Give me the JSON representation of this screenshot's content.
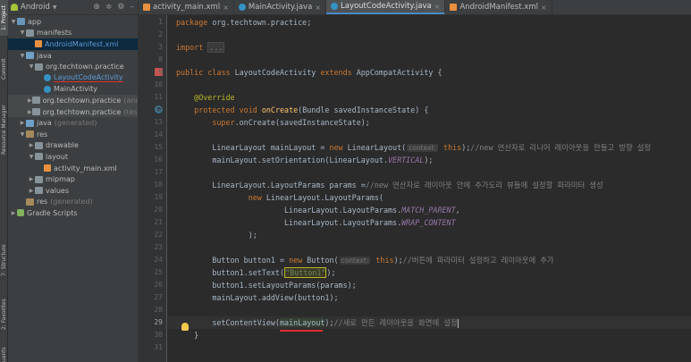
{
  "tool_strip": {
    "project": "1: Project",
    "commit": "Commit",
    "resource_manager": "Resource Manager",
    "structure": "7: Structure",
    "favorites": "2: Favorites",
    "build_variants": "uants"
  },
  "project_panel": {
    "view_selector": "Android",
    "tree": [
      {
        "label": "app",
        "indent": 0,
        "arrow": "▼",
        "icon": "folder-app"
      },
      {
        "label": "manifests",
        "indent": 1,
        "arrow": "▼",
        "icon": "folder"
      },
      {
        "label": "AndroidManifest.xml",
        "indent": 2,
        "arrow": "",
        "icon": "xml-file",
        "selected": true
      },
      {
        "label": "java",
        "indent": 1,
        "arrow": "▼",
        "icon": "folder-src"
      },
      {
        "label": "org.techtown.practice",
        "indent": 2,
        "arrow": "▼",
        "icon": "package"
      },
      {
        "label": "LayoutCodeActivity",
        "indent": 3,
        "arrow": "",
        "icon": "class"
      },
      {
        "label": "MainActivity",
        "indent": 3,
        "arrow": "",
        "icon": "class"
      },
      {
        "label": "org.techtown.practice",
        "suffix": "(andro",
        "indent": 2,
        "arrow": "▶",
        "icon": "package",
        "gray": true
      },
      {
        "label": "org.techtown.practice",
        "suffix": "(test)",
        "indent": 2,
        "arrow": "▶",
        "icon": "package",
        "gray": true
      },
      {
        "label": "java",
        "suffix": "(generated)",
        "indent": 1,
        "arrow": "▶",
        "icon": "folder-src"
      },
      {
        "label": "res",
        "indent": 1,
        "arrow": "▼",
        "icon": "folder-res"
      },
      {
        "label": "drawable",
        "indent": 2,
        "arrow": "▶",
        "icon": "folder"
      },
      {
        "label": "layout",
        "indent": 2,
        "arrow": "▼",
        "icon": "folder"
      },
      {
        "label": "activity_main.xml",
        "indent": 3,
        "arrow": "",
        "icon": "layout-file"
      },
      {
        "label": "mipmap",
        "indent": 2,
        "arrow": "▶",
        "icon": "folder"
      },
      {
        "label": "values",
        "indent": 2,
        "arrow": "▶",
        "icon": "folder"
      },
      {
        "label": "res",
        "suffix": "(generated)",
        "indent": 1,
        "arrow": "",
        "icon": "folder-res"
      },
      {
        "label": "Gradle Scripts",
        "indent": 0,
        "arrow": "▶",
        "icon": "gradle"
      }
    ]
  },
  "tabs": [
    {
      "label": "activity_main.xml",
      "icon": "layout-file"
    },
    {
      "label": "MainActivity.java",
      "icon": "class"
    },
    {
      "label": "LayoutCodeActivity.java",
      "icon": "class",
      "active": true
    },
    {
      "label": "AndroidManifest.xml",
      "icon": "xml-file"
    }
  ],
  "line_numbers": [
    "1",
    "2",
    "3",
    "8",
    "9",
    "10",
    "11",
    "12",
    "13",
    "14",
    "15",
    "16",
    "17",
    "18",
    "19",
    "20",
    "21",
    "22",
    "23",
    "24",
    "25",
    "26",
    "27",
    "28",
    "29",
    "30",
    "31"
  ],
  "current_line": "29",
  "code": {
    "l1_kw": "package",
    "l1_pkg": " org.techtown.practice;",
    "l3_kw": "import",
    "l3_fold": "...",
    "l8_kw1": "public",
    "l8_kw2": "class",
    "l8_name": " LayoutCodeActivity ",
    "l8_kw3": "extends",
    "l8_rest": " AppCompatActivity {",
    "l10_ann": "@Override",
    "l11_kw1": "protected",
    "l11_kw2": "void",
    "l11_fn": "onCreate",
    "l11_rest": "(Bundle savedInstanceState) {",
    "l12_kw": "super",
    "l12_rest": ".onCreate(savedInstanceState);",
    "l14_a": "LinearLayout mainLayout = ",
    "l14_kw": "new",
    "l14_b": " LinearLayout(",
    "l14_hint": "context:",
    "l14_this": "this",
    "l14_c": ");",
    "l14_cm": "//new 연산자로 리니어 레이아웃을 만들고 방향 설정",
    "l15_a": "mainLayout.setOrientation(LinearLayout.",
    "l15_cn": "VERTICAL",
    "l15_b": ");",
    "l17_a": "LinearLayout.LayoutParams params =",
    "l17_cm": "//new 연산자로 레이아웃 안에 추가도리 뷰들에 설정할 파라미터 생성",
    "l18_kw": "new",
    "l18_a": " LinearLayout.LayoutParams(",
    "l19_a": "LinearLayout.LayoutParams.",
    "l19_cn": "MATCH_PARENT",
    "l19_b": ",",
    "l20_a": "LinearLayout.LayoutParams.",
    "l20_cn": "WRAP_CONTENT",
    "l21_a": ");",
    "l23_a": "Button button1 = ",
    "l23_kw": "new",
    "l23_b": " Button(",
    "l23_hint": "context:",
    "l23_this": "this",
    "l23_c": ");",
    "l23_cm": "//버튼에 파라미터 설정하고 레이아웃에 추가",
    "l24_a": "button1.setText(",
    "l24_str": "\"Button1\"",
    "l24_b": ");",
    "l25_a": "button1.setLayoutParams(params);",
    "l26_a": "mainLayout.addView(button1);",
    "l28_a": "setContentView(",
    "l28_hl": "mainLayout",
    "l28_b": ");",
    "l28_cm": "//새로 만든 레이아웃을 화면에 설정",
    "l29_a": "}"
  }
}
